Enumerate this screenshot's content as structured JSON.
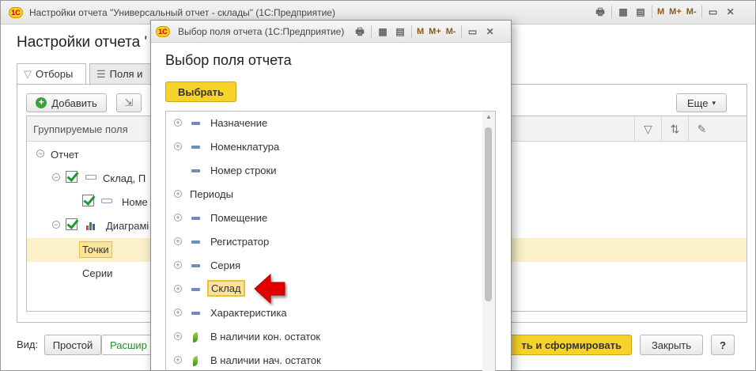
{
  "main_window": {
    "title": "Настройки отчета \"Универсальный отчет - склады\" (1С:Предприятие)",
    "heading": "Настройки отчета '",
    "logo": "1С",
    "toolbar": {
      "m": "M",
      "m_plus": "M+",
      "m_minus": "M-"
    },
    "tabs": [
      {
        "label": "Отборы",
        "icon": "funnel-icon"
      },
      {
        "label": "Поля и",
        "icon": "fields-icon"
      }
    ],
    "add_button": "Добавить",
    "more_button": "Еще",
    "tree": {
      "header": "Группируемые поля",
      "rows": [
        {
          "label": "Отчет"
        },
        {
          "label": "Склад, П"
        },
        {
          "label": "Номе"
        },
        {
          "label": "Диаграмі"
        },
        {
          "label": "Точки",
          "selected": true
        },
        {
          "label": "Серии"
        }
      ]
    },
    "view_label": "Вид:",
    "view_modes": [
      "Простой",
      "Расшир"
    ],
    "generate_button": "ть и сформировать",
    "close_button": "Закрыть",
    "help_button": "?"
  },
  "dialog": {
    "title": "Выбор поля отчета (1С:Предприятие)",
    "logo": "1С",
    "toolbar": {
      "m": "M",
      "m_plus": "M+",
      "m_minus": "M-"
    },
    "heading": "Выбор поля отчета",
    "choose_button": "Выбрать",
    "fields": [
      {
        "label": "Назначение",
        "expandable": true,
        "icon": "dash"
      },
      {
        "label": "Номенклатура",
        "expandable": true,
        "icon": "dash"
      },
      {
        "label": "Номер строки",
        "expandable": false,
        "icon": "dash"
      },
      {
        "label": "Периоды",
        "expandable": true,
        "icon": "none"
      },
      {
        "label": "Помещение",
        "expandable": true,
        "icon": "dash"
      },
      {
        "label": "Регистратор",
        "expandable": true,
        "icon": "dash"
      },
      {
        "label": "Серия",
        "expandable": true,
        "icon": "dash"
      },
      {
        "label": "Склад",
        "expandable": true,
        "icon": "dash",
        "selected": true
      },
      {
        "label": "Характеристика",
        "expandable": true,
        "icon": "dash"
      },
      {
        "label": "В наличии кон. остаток",
        "expandable": true,
        "icon": "leaf"
      },
      {
        "label": "В наличии нач. остаток",
        "expandable": true,
        "icon": "leaf"
      }
    ]
  },
  "colors": {
    "accent_yellow": "#f7d329",
    "selection": "#fbe39a",
    "arrow_red": "#e00000"
  }
}
